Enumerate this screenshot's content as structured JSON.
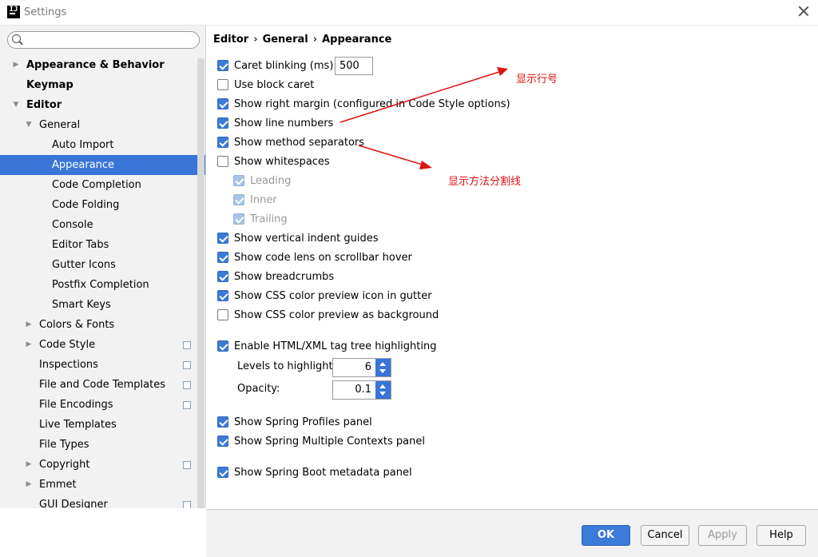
{
  "window": {
    "title": "Settings"
  },
  "sidebar": {
    "search_placeholder": "",
    "items": [
      {
        "label": "Appearance & Behavior",
        "level": 0,
        "arrow": "▶",
        "bold": true
      },
      {
        "label": "Keymap",
        "level": 0,
        "arrow": "",
        "bold": true
      },
      {
        "label": "Editor",
        "level": 0,
        "arrow": "▼",
        "bold": true
      },
      {
        "label": "General",
        "level": 1,
        "arrow": "▼"
      },
      {
        "label": "Auto Import",
        "level": 2,
        "arrow": ""
      },
      {
        "label": "Appearance",
        "level": 2,
        "arrow": "",
        "selected": true
      },
      {
        "label": "Code Completion",
        "level": 2,
        "arrow": ""
      },
      {
        "label": "Code Folding",
        "level": 2,
        "arrow": ""
      },
      {
        "label": "Console",
        "level": 2,
        "arrow": ""
      },
      {
        "label": "Editor Tabs",
        "level": 2,
        "arrow": ""
      },
      {
        "label": "Gutter Icons",
        "level": 2,
        "arrow": ""
      },
      {
        "label": "Postfix Completion",
        "level": 2,
        "arrow": ""
      },
      {
        "label": "Smart Keys",
        "level": 2,
        "arrow": ""
      },
      {
        "label": "Colors & Fonts",
        "level": 1,
        "arrow": "▶"
      },
      {
        "label": "Code Style",
        "level": 1,
        "arrow": "▶",
        "copy_icon": true
      },
      {
        "label": "Inspections",
        "level": 1,
        "arrow": "",
        "copy_icon": true
      },
      {
        "label": "File and Code Templates",
        "level": 1,
        "arrow": "",
        "copy_icon": true
      },
      {
        "label": "File Encodings",
        "level": 1,
        "arrow": "",
        "copy_icon": true
      },
      {
        "label": "Live Templates",
        "level": 1,
        "arrow": ""
      },
      {
        "label": "File Types",
        "level": 1,
        "arrow": ""
      },
      {
        "label": "Copyright",
        "level": 1,
        "arrow": "▶",
        "copy_icon": true
      },
      {
        "label": "Emmet",
        "level": 1,
        "arrow": "▶"
      },
      {
        "label": "GUI Designer",
        "level": 1,
        "arrow": "",
        "copy_icon": true
      }
    ]
  },
  "breadcrumb": {
    "parts": [
      "Editor",
      "General",
      "Appearance"
    ],
    "separator": "›"
  },
  "options": {
    "caret_blinking": {
      "label": "Caret blinking (ms):",
      "checked": true,
      "value": "500"
    },
    "use_block_caret": {
      "label": "Use block caret",
      "checked": false
    },
    "show_right_margin": {
      "label": "Show right margin (configured in Code Style options)",
      "checked": true
    },
    "show_line_numbers": {
      "label": "Show line numbers",
      "checked": true
    },
    "show_method_separators": {
      "label": "Show method separators",
      "checked": true
    },
    "show_whitespaces": {
      "label": "Show whitespaces",
      "checked": false
    },
    "leading": {
      "label": "Leading",
      "checked": true,
      "disabled": true
    },
    "inner": {
      "label": "Inner",
      "checked": true,
      "disabled": true
    },
    "trailing": {
      "label": "Trailing",
      "checked": true,
      "disabled": true
    },
    "show_vertical_indent_guides": {
      "label": "Show vertical indent guides",
      "checked": true
    },
    "show_code_lens": {
      "label": "Show code lens on scrollbar hover",
      "checked": true
    },
    "show_breadcrumbs": {
      "label": "Show breadcrumbs",
      "checked": true
    },
    "show_css_color_preview_icon": {
      "label": "Show CSS color preview icon in gutter",
      "checked": true
    },
    "show_css_color_preview_bg": {
      "label": "Show CSS color preview as background",
      "checked": false
    },
    "enable_tag_tree": {
      "label": "Enable HTML/XML tag tree highlighting",
      "checked": true
    },
    "levels_to_highlight": {
      "label": "Levels to highlight:",
      "value": "6"
    },
    "opacity": {
      "label": "Opacity:",
      "value": "0.1"
    },
    "spring_profiles": {
      "label": "Show Spring Profiles panel",
      "checked": true
    },
    "spring_multiple_contexts": {
      "label": "Show Spring Multiple Contexts panel",
      "checked": true
    },
    "spring_boot_metadata": {
      "label": "Show Spring Boot metadata panel",
      "checked": true
    }
  },
  "annotations": {
    "line_numbers": "显示行号",
    "method_separators": "显示方法分割线",
    "color": "#e01010"
  },
  "footer": {
    "ok": "OK",
    "cancel": "Cancel",
    "apply": "Apply",
    "help": "Help"
  },
  "colors": {
    "accent": "#3875d7",
    "sidebar_bg": "#f2f2f2"
  }
}
